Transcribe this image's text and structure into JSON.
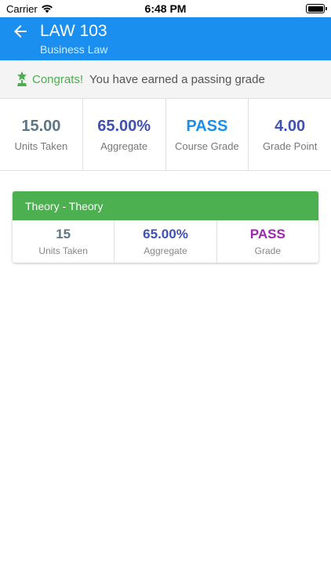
{
  "status_bar": {
    "carrier": "Carrier",
    "time": "6:48 PM"
  },
  "header": {
    "course_code": "LAW 103",
    "course_name": "Business Law",
    "background_color": "#1a8ff0",
    "back_icon": "arrow-left-icon"
  },
  "banner": {
    "icon": "trophy-icon",
    "title": "Congrats!",
    "message": "You have earned a passing grade"
  },
  "summary": [
    {
      "value": "15.00",
      "label": "Units Taken",
      "color": "#5d7685"
    },
    {
      "value": "65.00%",
      "label": "Aggregate",
      "color": "#3f51b5"
    },
    {
      "value": "PASS",
      "label": "Course Grade",
      "color": "#1a8ff0"
    },
    {
      "value": "4.00",
      "label": "Grade Point",
      "color": "#3f51b5"
    }
  ],
  "components": [
    {
      "title": "Theory - Theory",
      "header_color": "#4caf50",
      "stats": [
        {
          "value": "15",
          "label": "Units Taken",
          "color": "#5d7685"
        },
        {
          "value": "65.00%",
          "label": "Aggregate",
          "color": "#3f51b5"
        },
        {
          "value": "PASS",
          "label": "Grade",
          "color": "#9c27b0"
        }
      ]
    }
  ]
}
